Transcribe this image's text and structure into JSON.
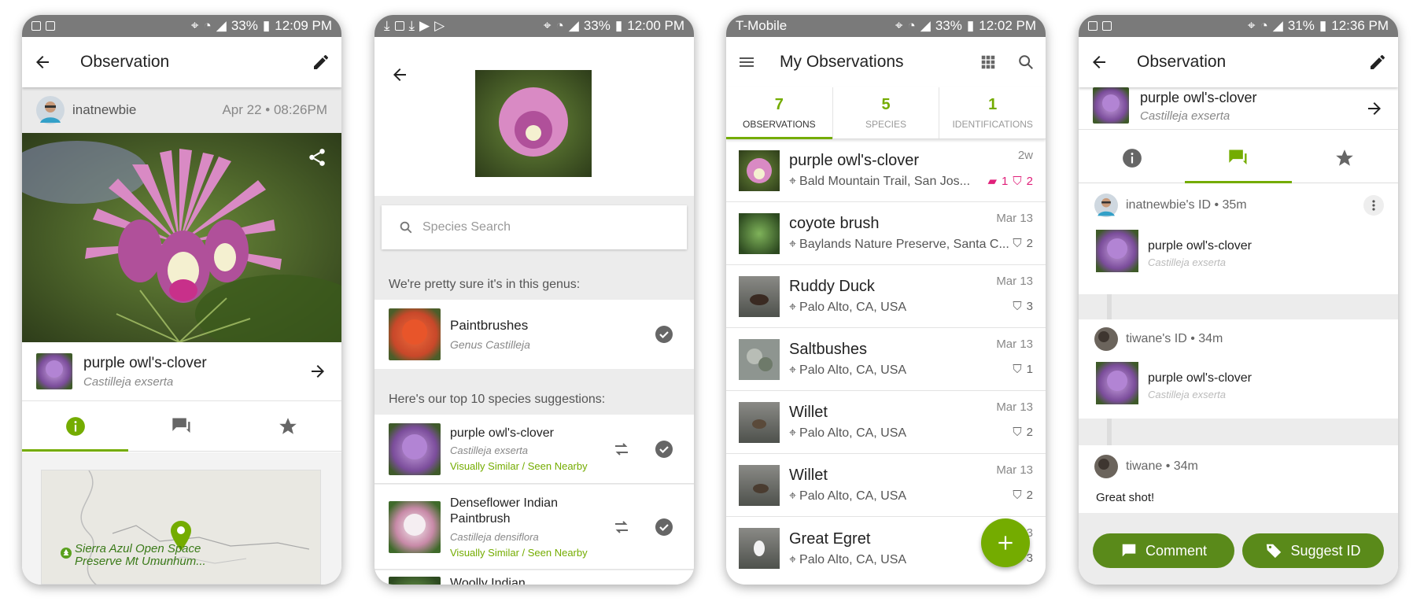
{
  "phone1": {
    "status": {
      "battery": "33%",
      "time": "12:09 PM"
    },
    "title": "Observation",
    "user": "inatnewbie",
    "date": "Apr 22 • 08:26PM",
    "taxon": {
      "common": "purple owl's-clover",
      "scientific": "Castilleja exserta"
    },
    "map": {
      "place": "Sierra Azul Open Space Preserve Mt Umunhum..."
    }
  },
  "phone2": {
    "status": {
      "battery": "33%",
      "time": "12:00 PM"
    },
    "search": {
      "placeholder": "Species Search"
    },
    "genus_header": "We're pretty sure it's in this genus:",
    "genus": {
      "name": "Paintbrushes",
      "rank": "Genus Castilleja"
    },
    "top_header": "Here's our top 10 species suggestions:",
    "suggestions": [
      {
        "name": "purple owl's-clover",
        "scientific": "Castilleja exserta",
        "note": "Visually Similar / Seen Nearby"
      },
      {
        "name": "Denseflower Indian Paintbrush",
        "scientific": "Castilleja densiflora",
        "note": "Visually Similar / Seen Nearby"
      },
      {
        "name": "Woolly Indian"
      }
    ]
  },
  "phone3": {
    "status": {
      "carrier": "T-Mobile",
      "battery": "33%",
      "time": "12:02 PM"
    },
    "title": "My Observations",
    "tabs": [
      {
        "count": "7",
        "label": "OBSERVATIONS"
      },
      {
        "count": "5",
        "label": "SPECIES"
      },
      {
        "count": "1",
        "label": "IDENTIFICATIONS"
      }
    ],
    "rows": [
      {
        "name": "purple owl's-clover",
        "place": "Bald Mountain Trail, San Jos...",
        "date": "2w",
        "comments": "1",
        "ids": "2"
      },
      {
        "name": "coyote brush",
        "place": "Baylands Nature Preserve, Santa C...",
        "date": "Mar 13",
        "ids": "2"
      },
      {
        "name": "Ruddy Duck",
        "place": "Palo Alto, CA, USA",
        "date": "Mar 13",
        "ids": "3"
      },
      {
        "name": "Saltbushes",
        "place": "Palo Alto, CA, USA",
        "date": "Mar 13",
        "ids": "1"
      },
      {
        "name": "Willet",
        "place": "Palo Alto, CA, USA",
        "date": "Mar 13",
        "ids": "2"
      },
      {
        "name": "Willet",
        "place": "Palo Alto, CA, USA",
        "date": "Mar 13",
        "ids": "2"
      },
      {
        "name": "Great Egret",
        "place": "Palo Alto, CA, USA",
        "date": "Mar 13",
        "ids": "3"
      }
    ]
  },
  "phone4": {
    "status": {
      "battery": "31%",
      "time": "12:36 PM"
    },
    "title": "Observation",
    "taxon": {
      "common": "purple owl's-clover",
      "scientific": "Castilleja exserta"
    },
    "ids": [
      {
        "header": "inatnewbie's ID • 35m",
        "common": "purple owl's-clover",
        "scientific": "Castilleja exserta"
      },
      {
        "header": "tiwane's ID • 34m",
        "common": "purple owl's-clover",
        "scientific": "Castilleja exserta"
      }
    ],
    "comment": {
      "header": "tiwane • 34m",
      "body": "Great shot!"
    },
    "buttons": {
      "comment": "Comment",
      "suggest": "Suggest ID"
    }
  },
  "colors": {
    "accent": "#74ac00",
    "pink": "#e0207a",
    "statusbar": "#7a7a7a"
  }
}
